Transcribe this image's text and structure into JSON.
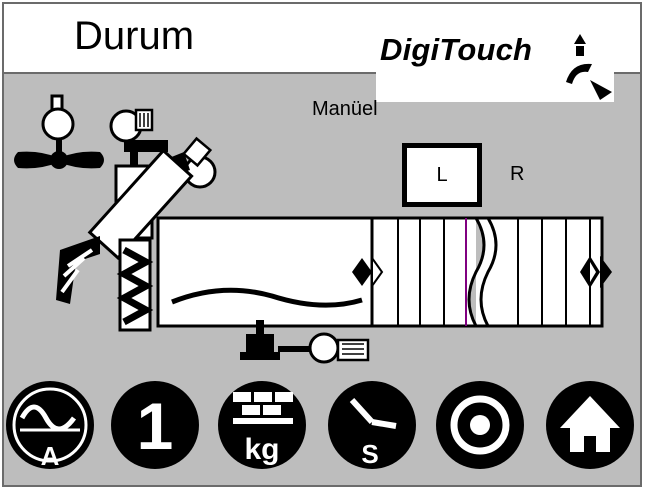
{
  "header": {
    "title": "Durum",
    "brand": "DigiTouch"
  },
  "machine": {
    "mode_label": "Manüel",
    "side_left": "L",
    "side_right": "R",
    "selected_side": "L"
  },
  "bottom_buttons": [
    {
      "id": "ampere",
      "icon": "sine-wave-ampere-icon",
      "label": "A"
    },
    {
      "id": "number",
      "icon": "number-one-icon",
      "label": "1"
    },
    {
      "id": "weight",
      "icon": "weight-bricks-icon",
      "label": "kg"
    },
    {
      "id": "timer",
      "icon": "clock-seconds-icon",
      "label": "S"
    },
    {
      "id": "target",
      "icon": "target-circle-icon"
    },
    {
      "id": "home",
      "icon": "home-icon"
    }
  ],
  "colors": {
    "background": "#bdbdbd",
    "icon": "#000000",
    "header": "#ffffff"
  }
}
